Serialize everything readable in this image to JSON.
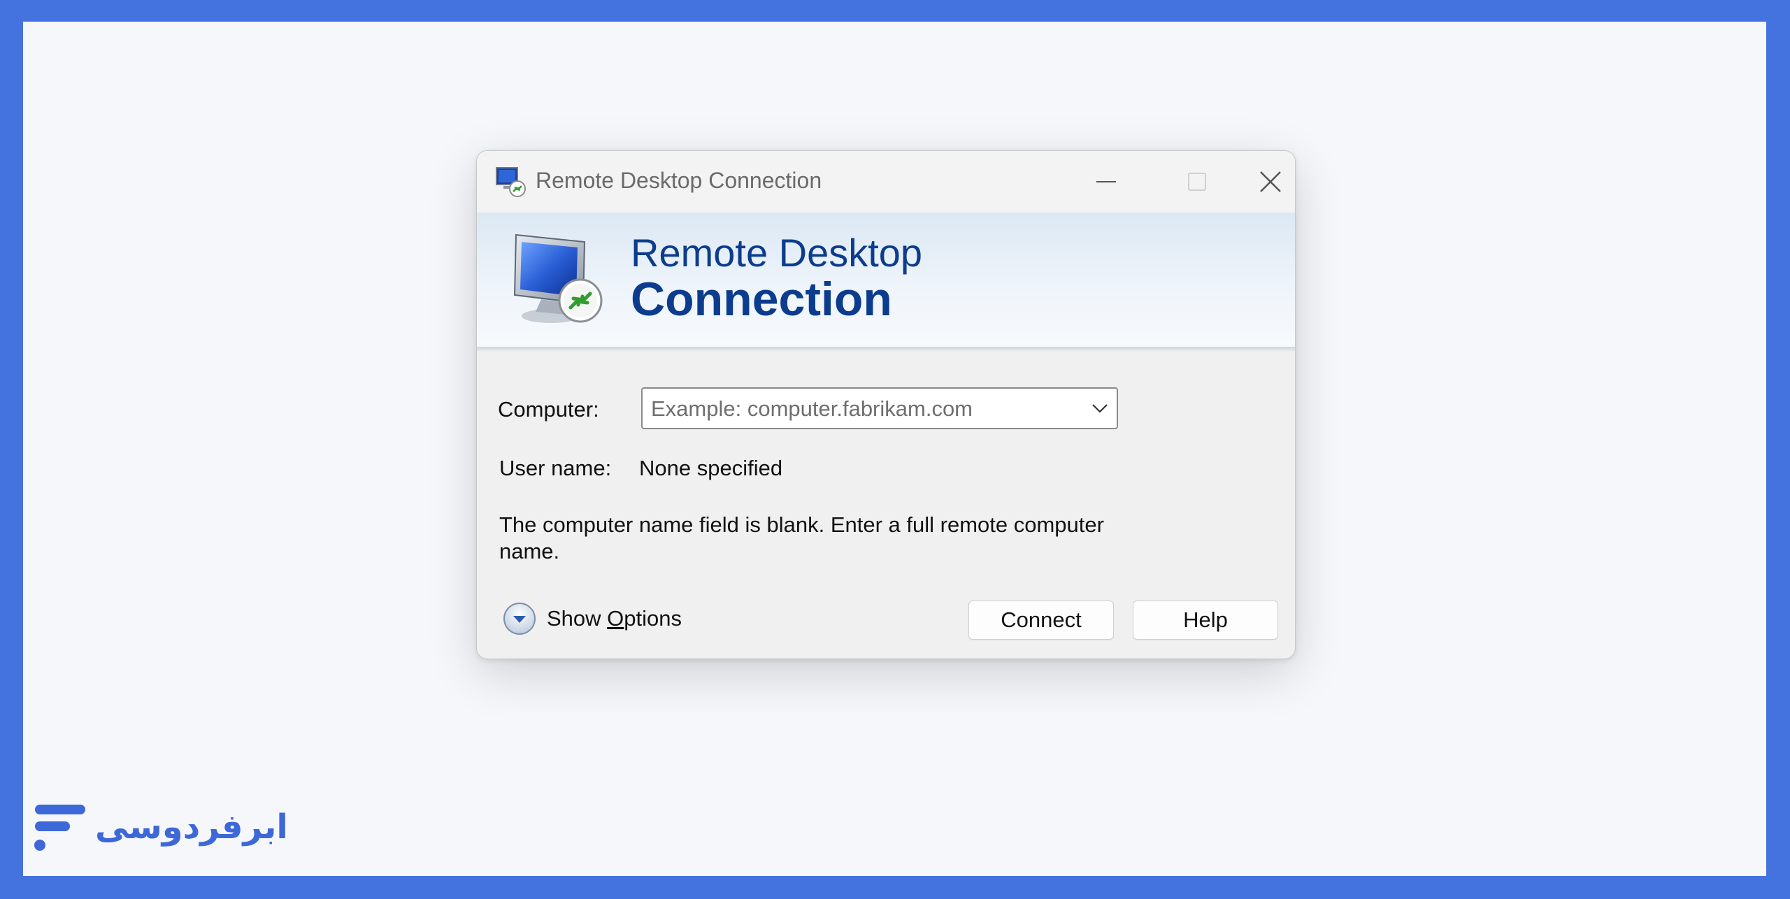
{
  "window": {
    "title": "Remote Desktop Connection",
    "controls": {
      "minimize": "minimize-icon",
      "maximize": "maximize-icon",
      "close": "close-icon"
    }
  },
  "banner": {
    "line1": "Remote Desktop",
    "line2": "Connection",
    "icon": "remote-desktop-monitor-icon"
  },
  "form": {
    "computer_label": "Computer:",
    "computer_placeholder": "Example: computer.fabrikam.com",
    "computer_value": "",
    "username_label": "User name:",
    "username_value": "None specified",
    "message": "The computer name field is blank. Enter a full remote computer name."
  },
  "footer": {
    "show_options_prefix": "Show ",
    "show_options_underlined": "O",
    "show_options_suffix": "ptions",
    "connect_label": "Connect",
    "help_label": "Help"
  },
  "watermark": {
    "text": "ابرفردوسی"
  },
  "colors": {
    "frame": "#4472df",
    "canvas": "#f5f7fb",
    "banner_text": "#0c3c8d",
    "dialog_bg": "#f0f0f0"
  }
}
